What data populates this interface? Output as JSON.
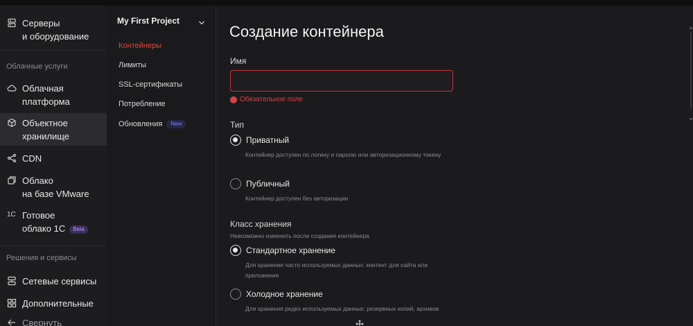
{
  "sidebar": {
    "items": [
      {
        "line1": "Серверы",
        "line2": "и оборудование",
        "icon": "server-icon"
      },
      {
        "line1": "Облачная",
        "line2": "платформа",
        "icon": "cloud-icon"
      },
      {
        "line1": "Объектное",
        "line2": "хранилище",
        "icon": "cube-icon"
      },
      {
        "line1": "CDN",
        "line2": "",
        "icon": "cdn-icon"
      },
      {
        "line1": "Облако",
        "line2": "на базе VMware",
        "icon": "vmware-icon"
      },
      {
        "line1": "Готовое",
        "line2": "облако 1С",
        "icon": "1c-icon",
        "badge": "Beta"
      },
      {
        "line1": "Сетевые сервисы",
        "line2": "",
        "icon": "network-icon"
      },
      {
        "line1": "Дополнительные",
        "line2": "",
        "icon": "grid-icon"
      },
      {
        "line1": "Свернуть",
        "line2": "",
        "icon": "arrow-left-icon"
      }
    ],
    "sections": {
      "cloud": "Облачные услуги",
      "solutions": "Решения и сервисы"
    },
    "onec_icon_text": "1С"
  },
  "project_menu": {
    "title": "My First Project",
    "items": [
      {
        "label": "Контейнеры",
        "active": true
      },
      {
        "label": "Лимиты"
      },
      {
        "label": "SSL-сертификаты"
      },
      {
        "label": "Потребление"
      },
      {
        "label": "Обновления",
        "badge": "New"
      }
    ]
  },
  "main": {
    "title": "Создание контейнера",
    "name_label": "Имя",
    "name_value": "",
    "name_error": "Обязательное поле",
    "type_label": "Тип",
    "type_options": [
      {
        "label": "Приватный",
        "hint": "Контейнер доступен по логину и паролю или авторизационному токену",
        "checked": true
      },
      {
        "label": "Публичный",
        "hint": "Контейнер доступен без авторизации",
        "checked": false
      }
    ],
    "storage_label": "Класс хранения",
    "storage_hint": "Невозможно изменить после создания контейнера",
    "storage_options": [
      {
        "label": "Стандартное хранение",
        "hint": "Для хранения часто используемых данных: контент для сайта или приложения",
        "checked": true
      },
      {
        "label": "Холодное хранение",
        "hint": "Для хранения редко используемых данных: резервных копий, архивов",
        "checked": false
      }
    ]
  },
  "colors": {
    "accent_red": "#e0443e",
    "beta_purple": "#b79cf0",
    "new_blue": "#7b86e8"
  }
}
